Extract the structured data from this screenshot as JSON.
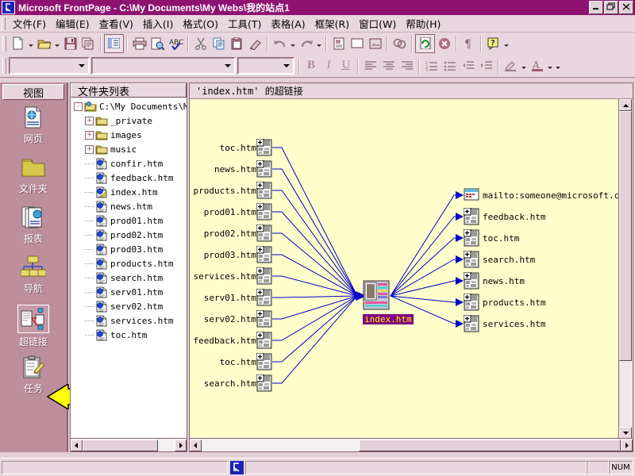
{
  "window": {
    "title": "Microsoft FrontPage - C:\\My Documents\\My Webs\\我的站点1",
    "app_icon": "frontpage-icon",
    "minimize_label": "_",
    "maximize_label": "❐",
    "close_label": "✕"
  },
  "menubar": {
    "items": [
      {
        "label": "文件(F)",
        "name": "menu-file"
      },
      {
        "label": "编辑(E)",
        "name": "menu-edit"
      },
      {
        "label": "查看(V)",
        "name": "menu-view"
      },
      {
        "label": "插入(I)",
        "name": "menu-insert"
      },
      {
        "label": "格式(O)",
        "name": "menu-format"
      },
      {
        "label": "工具(T)",
        "name": "menu-tools"
      },
      {
        "label": "表格(A)",
        "name": "menu-table"
      },
      {
        "label": "框架(R)",
        "name": "menu-frames"
      },
      {
        "label": "窗口(W)",
        "name": "menu-window"
      },
      {
        "label": "帮助(H)",
        "name": "menu-help"
      }
    ]
  },
  "toolbar_standard": {
    "buttons": [
      {
        "name": "new-page-button",
        "icon": "new-document-icon"
      },
      {
        "name": "new-page-dropdown",
        "icon": "chevron-down-icon"
      },
      {
        "name": "open-button",
        "icon": "open-folder-icon"
      },
      {
        "name": "open-dropdown",
        "icon": "chevron-down-icon"
      },
      {
        "name": "save-button",
        "icon": "floppy-disk-icon"
      },
      {
        "name": "publish-web-button",
        "icon": "publish-icon"
      },
      {
        "name": "folder-list-toggle-button",
        "icon": "folder-list-icon"
      },
      {
        "name": "print-button",
        "icon": "printer-icon"
      },
      {
        "name": "print-preview-button",
        "icon": "print-preview-icon"
      },
      {
        "name": "spelling-button",
        "icon": "spell-check-icon"
      },
      {
        "name": "cut-button",
        "icon": "scissors-icon"
      },
      {
        "name": "copy-button",
        "icon": "copy-icon"
      },
      {
        "name": "paste-button",
        "icon": "clipboard-icon"
      },
      {
        "name": "format-painter-button",
        "icon": "paint-brush-icon"
      },
      {
        "name": "undo-button",
        "icon": "undo-arrow-icon"
      },
      {
        "name": "undo-dropdown",
        "icon": "chevron-down-icon"
      },
      {
        "name": "redo-button",
        "icon": "redo-arrow-icon"
      },
      {
        "name": "redo-dropdown",
        "icon": "chevron-down-icon"
      },
      {
        "name": "insert-component-button",
        "icon": "component-icon"
      },
      {
        "name": "insert-table-button",
        "icon": "table-icon"
      },
      {
        "name": "insert-picture-button",
        "icon": "picture-icon"
      },
      {
        "name": "hyperlink-button",
        "icon": "link-globe-icon"
      },
      {
        "name": "refresh-button",
        "icon": "refresh-icon"
      },
      {
        "name": "stop-button",
        "icon": "stop-icon"
      },
      {
        "name": "show-marks-button",
        "icon": "paragraph-mark-icon"
      },
      {
        "name": "help-button",
        "icon": "question-help-icon"
      },
      {
        "name": "toolbar-overflow-button",
        "icon": "chevron-down-icon"
      }
    ]
  },
  "toolbar_formatting": {
    "style_combo": {
      "name": "style-combo",
      "value": ""
    },
    "font_combo": {
      "name": "font-combo",
      "value": ""
    },
    "size_combo": {
      "name": "font-size-combo",
      "value": ""
    },
    "bold_label": "B",
    "italic_label": "I",
    "underline_label": "U",
    "buttons": [
      {
        "name": "align-left-button",
        "icon": "align-left-icon"
      },
      {
        "name": "align-center-button",
        "icon": "align-center-icon"
      },
      {
        "name": "align-right-button",
        "icon": "align-right-icon"
      },
      {
        "name": "numbered-list-button",
        "icon": "ordered-list-icon"
      },
      {
        "name": "bulleted-list-button",
        "icon": "bulleted-list-icon"
      },
      {
        "name": "decrease-indent-button",
        "icon": "decrease-indent-icon"
      },
      {
        "name": "increase-indent-button",
        "icon": "increase-indent-icon"
      },
      {
        "name": "highlight-button",
        "icon": "highlighter-icon"
      },
      {
        "name": "highlight-dropdown",
        "icon": "chevron-down-icon"
      },
      {
        "name": "font-color-button",
        "icon": "font-color-icon"
      },
      {
        "name": "font-color-dropdown",
        "icon": "chevron-down-icon"
      },
      {
        "name": "formatting-overflow-button",
        "icon": "chevron-down-icon"
      }
    ]
  },
  "views_bar": {
    "header": "视图",
    "items": [
      {
        "label": "网页",
        "name": "view-page",
        "icon": "page-view-icon",
        "selected": false
      },
      {
        "label": "文件夹",
        "name": "view-folders",
        "icon": "folder-view-icon",
        "selected": false
      },
      {
        "label": "报表",
        "name": "view-reports",
        "icon": "reports-view-icon",
        "selected": false
      },
      {
        "label": "导航",
        "name": "view-navigation",
        "icon": "navigation-view-icon",
        "selected": false
      },
      {
        "label": "超链接",
        "name": "view-hyperlinks",
        "icon": "hyperlinks-view-icon",
        "selected": true
      },
      {
        "label": "任务",
        "name": "view-tasks",
        "icon": "tasks-view-icon",
        "selected": false
      }
    ]
  },
  "folder_list": {
    "header": "文件夹列表",
    "tree": [
      {
        "label": "C:\\My Documents\\M",
        "indent": 0,
        "toggle": "-",
        "icon": "open-web-folder-icon",
        "name": "tree-root"
      },
      {
        "label": "_private",
        "indent": 1,
        "toggle": "+",
        "icon": "folder-icon",
        "name": "tree-folder-private"
      },
      {
        "label": "images",
        "indent": 1,
        "toggle": "+",
        "icon": "folder-icon",
        "name": "tree-folder-images"
      },
      {
        "label": "music",
        "indent": 1,
        "toggle": "+",
        "icon": "folder-icon",
        "name": "tree-folder-music"
      },
      {
        "label": "confir.htm",
        "indent": 1,
        "toggle": "",
        "icon": "html-page-icon",
        "name": "tree-file-confir"
      },
      {
        "label": "feedback.htm",
        "indent": 1,
        "toggle": "",
        "icon": "html-page-icon",
        "name": "tree-file-feedback"
      },
      {
        "label": "index.htm",
        "indent": 1,
        "toggle": "",
        "icon": "html-page-edit-icon",
        "name": "tree-file-index"
      },
      {
        "label": "news.htm",
        "indent": 1,
        "toggle": "",
        "icon": "html-page-icon",
        "name": "tree-file-news"
      },
      {
        "label": "prod01.htm",
        "indent": 1,
        "toggle": "",
        "icon": "html-page-icon",
        "name": "tree-file-prod01"
      },
      {
        "label": "prod02.htm",
        "indent": 1,
        "toggle": "",
        "icon": "html-page-icon",
        "name": "tree-file-prod02"
      },
      {
        "label": "prod03.htm",
        "indent": 1,
        "toggle": "",
        "icon": "html-page-icon",
        "name": "tree-file-prod03"
      },
      {
        "label": "products.htm",
        "indent": 1,
        "toggle": "",
        "icon": "html-page-icon",
        "name": "tree-file-products"
      },
      {
        "label": "search.htm",
        "indent": 1,
        "toggle": "",
        "icon": "html-page-icon",
        "name": "tree-file-search"
      },
      {
        "label": "serv01.htm",
        "indent": 1,
        "toggle": "",
        "icon": "html-page-icon",
        "name": "tree-file-serv01"
      },
      {
        "label": "serv02.htm",
        "indent": 1,
        "toggle": "",
        "icon": "html-page-icon",
        "name": "tree-file-serv02"
      },
      {
        "label": "services.htm",
        "indent": 1,
        "toggle": "",
        "icon": "html-page-icon",
        "name": "tree-file-services"
      },
      {
        "label": "toc.htm",
        "indent": 1,
        "toggle": "",
        "icon": "html-page-icon",
        "name": "tree-file-toc"
      }
    ]
  },
  "hyperlink_view": {
    "header": "'index.htm' 的超链接",
    "center": {
      "label": "index.htm",
      "name": "hyperlink-center-node"
    },
    "incoming": [
      {
        "label": "toc.htm"
      },
      {
        "label": "news.htm"
      },
      {
        "label": "products.htm"
      },
      {
        "label": "prod01.htm"
      },
      {
        "label": "prod02.htm"
      },
      {
        "label": "prod03.htm"
      },
      {
        "label": "services.htm"
      },
      {
        "label": "serv01.htm"
      },
      {
        "label": "serv02.htm"
      },
      {
        "label": "feedback.htm"
      },
      {
        "label": "toc.htm"
      },
      {
        "label": "search.htm"
      }
    ],
    "outgoing": [
      {
        "label": "mailto:someone@microsoft.com",
        "icon": "mail-icon"
      },
      {
        "label": "feedback.htm",
        "icon": "html-page-icon"
      },
      {
        "label": "toc.htm",
        "icon": "html-page-icon"
      },
      {
        "label": "search.htm",
        "icon": "html-page-icon"
      },
      {
        "label": "news.htm",
        "icon": "html-page-icon"
      },
      {
        "label": "products.htm",
        "icon": "html-page-icon"
      },
      {
        "label": "services.htm",
        "icon": "html-page-icon"
      }
    ]
  },
  "statusbar": {
    "message": "",
    "mode_icon": "pointer-icon",
    "num_indicator": "NUM"
  },
  "colors": {
    "title_bar": "#8e1271",
    "chrome": "#e8d7de",
    "views_bar": "#bd8e9c",
    "canvas": "#ffffcc",
    "link_line": "#0000c8",
    "selected_label_bg": "#800080",
    "selected_label_fg": "#ffff00"
  }
}
